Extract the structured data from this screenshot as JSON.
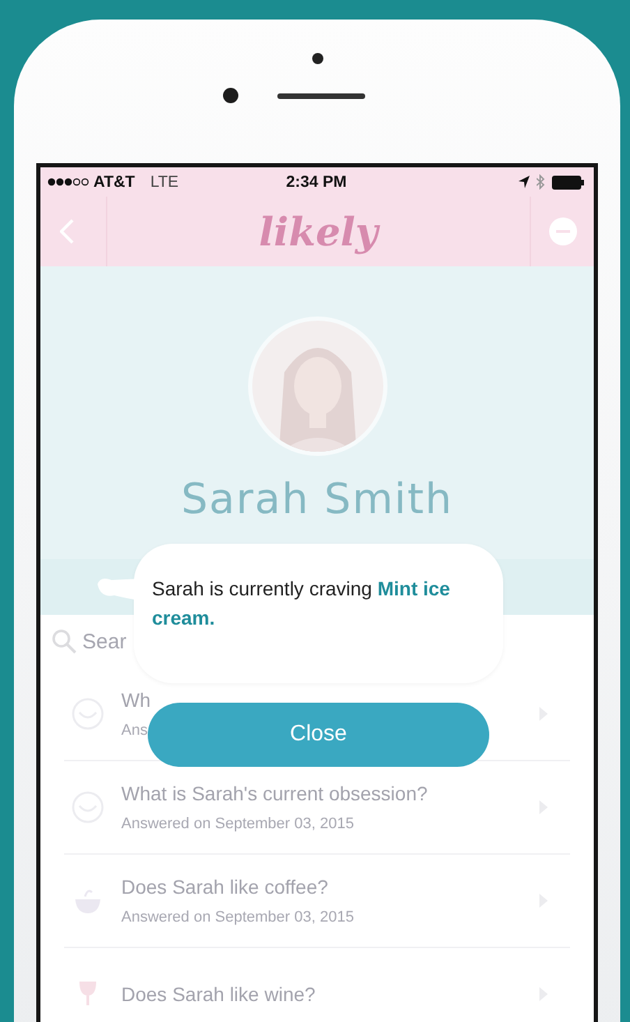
{
  "status_bar": {
    "carrier": "AT&T",
    "network": "LTE",
    "time": "2:34 PM"
  },
  "nav": {
    "logo": "likely"
  },
  "profile": {
    "name": "Sarah Smith"
  },
  "search": {
    "placeholder": "Sear"
  },
  "questions": [
    {
      "kind": "smiley",
      "title": "Wh",
      "subtitle": "Ans"
    },
    {
      "kind": "smiley",
      "title": "What is Sarah's current obsession?",
      "subtitle": "Answered on September 03, 2015"
    },
    {
      "kind": "cup",
      "title": "Does Sarah like coffee?",
      "subtitle": "Answered on September 03, 2015"
    },
    {
      "kind": "glass",
      "title": "Does Sarah like wine?"
    }
  ],
  "popup": {
    "message": "Sarah is currently craving **Mint ice cream.**",
    "button": "Close"
  }
}
